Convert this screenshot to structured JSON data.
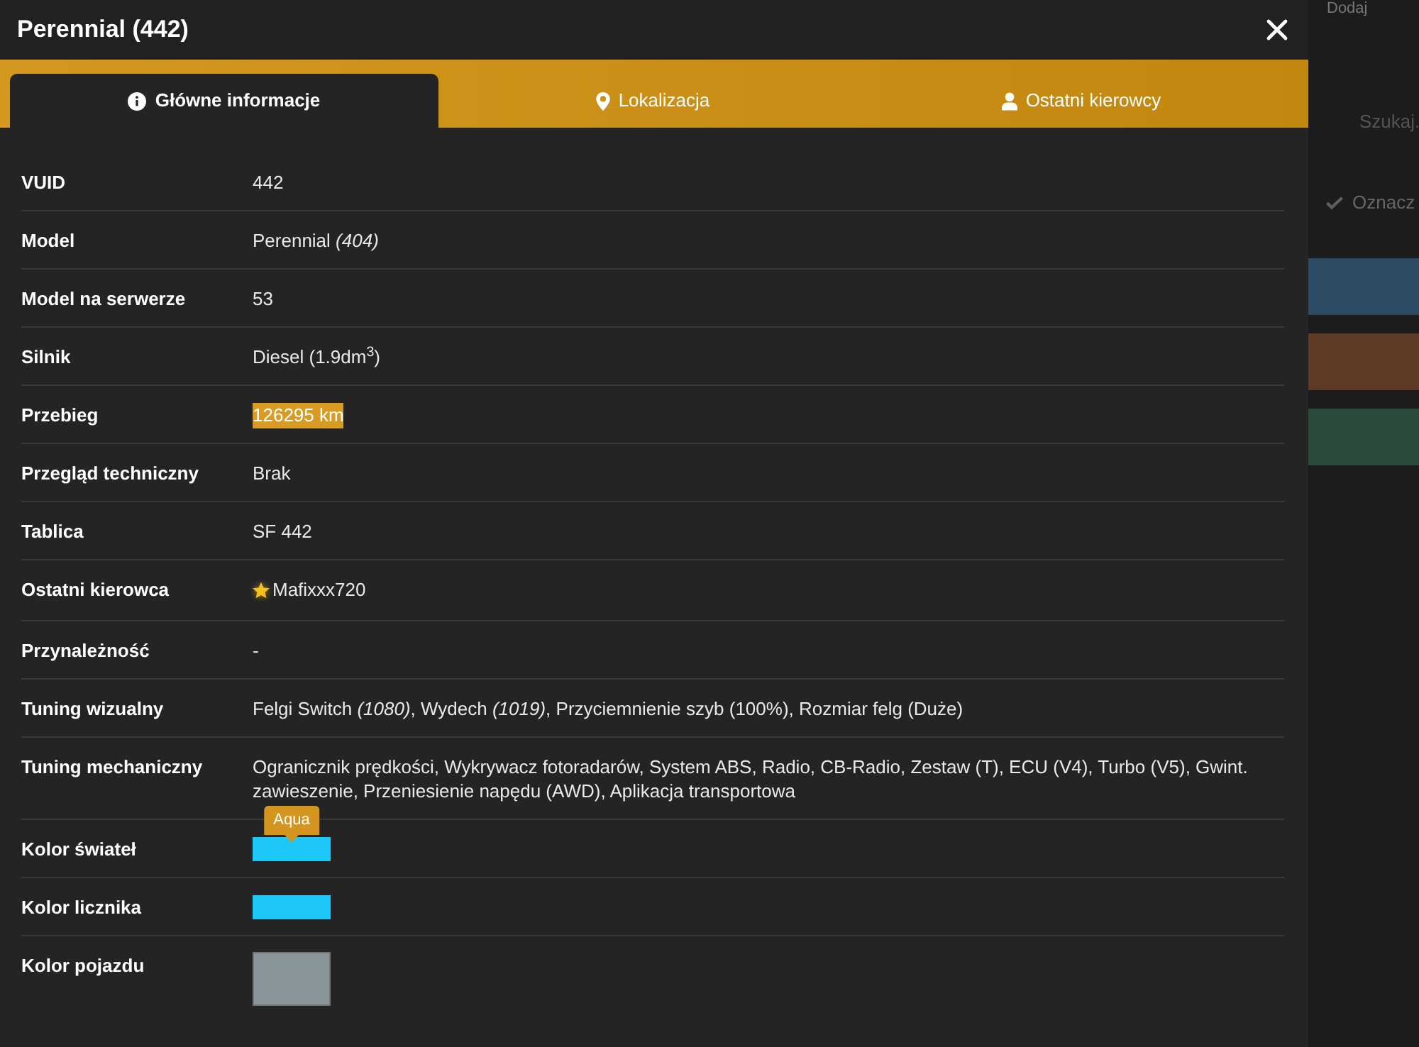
{
  "window": {
    "title": "Perennial (442)"
  },
  "tabs": [
    {
      "label": "Główne informacje",
      "selected": true
    },
    {
      "label": "Lokalizacja",
      "selected": false
    },
    {
      "label": "Ostatni kierowcy",
      "selected": false
    }
  ],
  "details": [
    {
      "kind": "text",
      "label": "VUID",
      "value": "442",
      "highlighted": false
    },
    {
      "kind": "text",
      "label": "Model",
      "value": "Perennial *(404)*",
      "highlighted": false
    },
    {
      "kind": "text",
      "label": "Model na serwerze",
      "value": "53",
      "highlighted": false
    },
    {
      "kind": "text",
      "label": "Silnik",
      "value": "Diesel (1.9dm$^{3}$)",
      "highlighted": false
    },
    {
      "kind": "text",
      "label": "Przebieg",
      "value": "126295 km",
      "highlighted": true
    },
    {
      "kind": "text",
      "label": "Przegląd techniczny",
      "value": "Brak",
      "highlighted": false
    },
    {
      "kind": "text",
      "label": "Tablica",
      "value": "SF 442",
      "highlighted": false
    },
    {
      "kind": "driver",
      "label": "Ostatni kierowca",
      "value": "Mafixxx720"
    },
    {
      "kind": "text",
      "label": "Przynależność",
      "value": "-",
      "highlighted": false
    },
    {
      "kind": "text",
      "label": "Tuning wizualny",
      "value": "Felgi Switch *(1080)*, Wydech *(1019)*, Przyciemnienie szyb (100%), Rozmiar felg (Duże)",
      "highlighted": false
    },
    {
      "kind": "text",
      "label": "Tuning mechaniczny",
      "value": "Ogranicznik prędkości, Wykrywacz fotoradarów, System ABS, Radio, CB-Radio, Zestaw (T), ECU (V4), Turbo (V5), Gwint. zawieszenie, Przeniesienie napędu (AWD), Aplikacja transportowa",
      "highlighted": false
    },
    {
      "kind": "swatch",
      "label": "Kolor świateł",
      "color": "#1ec9fa",
      "tooltip": "Aqua"
    },
    {
      "kind": "swatch",
      "label": "Kolor licznika",
      "color": "#1ec9fa"
    },
    {
      "kind": "tall_swatch",
      "label": "Kolor pojazdu",
      "color": "#8a9499"
    }
  ],
  "background_page": {
    "button": "Dodaj",
    "search": {
      "placeholder": "Szukaj."
    },
    "mark_button": "Oznacz",
    "rows": [
      {
        "color": "#2c4b62"
      },
      {
        "color": "#5b3b26"
      },
      {
        "color": "#2a4b3c"
      }
    ]
  }
}
